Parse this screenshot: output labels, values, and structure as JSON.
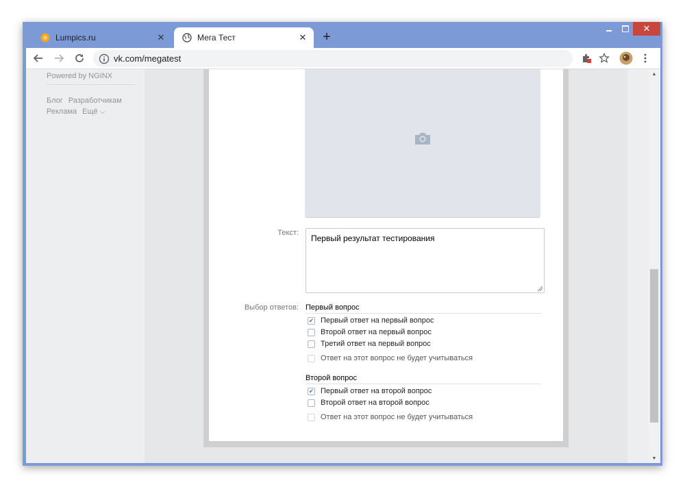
{
  "browser": {
    "tabs": [
      {
        "title": "Lumpics.ru",
        "close": "✕"
      },
      {
        "title": "Мега Тест",
        "close": "✕"
      }
    ],
    "new_tab": "+",
    "url": "vk.com/megatest",
    "window_controls": {
      "minimize": "minimize-icon",
      "maximize": "maximize-icon",
      "close": "✕"
    }
  },
  "left_panel": {
    "powered": "Powered by NGINX",
    "links": [
      "Блог",
      "Разработчикам",
      "Реклама",
      "Ещё ⌵"
    ]
  },
  "form": {
    "text_label": "Текст:",
    "text_value": "Первый результат тестирования",
    "answers_label": "Выбор ответов:",
    "questions": [
      {
        "title": "Первый вопрос",
        "options": [
          {
            "label": "Первый ответ на первый вопрос",
            "checked": true
          },
          {
            "label": "Второй ответ на первый вопрос",
            "checked": false
          },
          {
            "label": "Третий ответ на первый вопрос",
            "checked": false
          }
        ],
        "ignore_label": "Ответ на этот вопрос не будет учитываться"
      },
      {
        "title": "Второй вопрос",
        "options": [
          {
            "label": "Первый ответ на второй вопрос",
            "checked": true
          },
          {
            "label": "Второй ответ на второй вопрос",
            "checked": false
          }
        ],
        "ignore_label": "Ответ на этот вопрос не будет учитываться"
      }
    ]
  },
  "colors": {
    "titlebar": "#7c9ad6",
    "close_button": "#c9463d",
    "accent": "#4a76a8"
  }
}
